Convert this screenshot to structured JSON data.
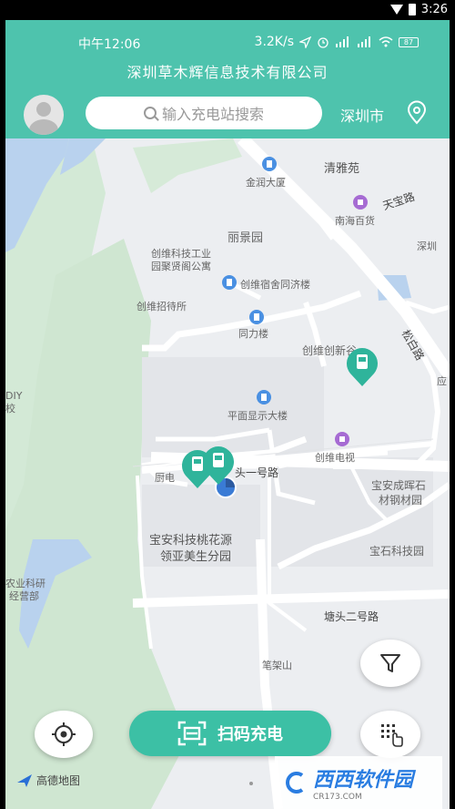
{
  "system_status": {
    "time": "3:26"
  },
  "inner_status": {
    "time": "中午12:06",
    "network_speed": "3.2K/s",
    "battery": "87"
  },
  "header": {
    "company_name": "深圳草木辉信息技术有限公司",
    "search_placeholder": "输入充电站搜索",
    "city": "深圳市"
  },
  "map": {
    "labels": {
      "qingyayuan": "清雅苑",
      "jinrundasha": "金润大厦",
      "tianbaolu": "天宝路",
      "nanhaibaihuo": "南海百货",
      "shenzhen_edge": "深圳",
      "lijingyuan": "丽景园",
      "chuangwei_industry": "创维科技工业",
      "chuangwei_industry2": "园聚贤阁公寓",
      "chuangwei_dorm": "创维宿舍同济楼",
      "chuangwei_guest": "创维招待所",
      "tonglilou": "同力楼",
      "chuangwei_chuangxingu": "创维创新谷",
      "songbailu": "松白路",
      "pingmian": "平面显示大楼",
      "diy_edge": "DIY",
      "edge_xiao": "校",
      "chuangwei_tv": "创维电视",
      "chudian_edge": "厨电",
      "tangtou_yihao": "头一号路",
      "baoan_steel": "宝安成晖石",
      "baoan_steel2": "材钢材园",
      "baoan_peach": "宝安科技桃花源",
      "lingya": "领亚美生分园",
      "baoshi": "宝石科技园",
      "agri_research": "农业科研",
      "agri_research2": "经营部",
      "tangtou_erhao": "塘头二号路",
      "bijiashan": "笔架山",
      "edge_ying": "应"
    },
    "provider": "高德地图"
  },
  "actions": {
    "scan_charge": "扫码充电"
  },
  "watermark": {
    "brand": "西西软件园",
    "site": "CR173.COM"
  },
  "colors": {
    "brand_teal": "#4ec3ad",
    "scan_button": "#3cc0a5",
    "station_marker": "#2fb49b"
  },
  "icons": [
    "avatar",
    "search-icon",
    "location-pin-icon",
    "filter-icon",
    "locate-icon",
    "keypad-icon",
    "scan-icon",
    "charging-station-icon"
  ]
}
